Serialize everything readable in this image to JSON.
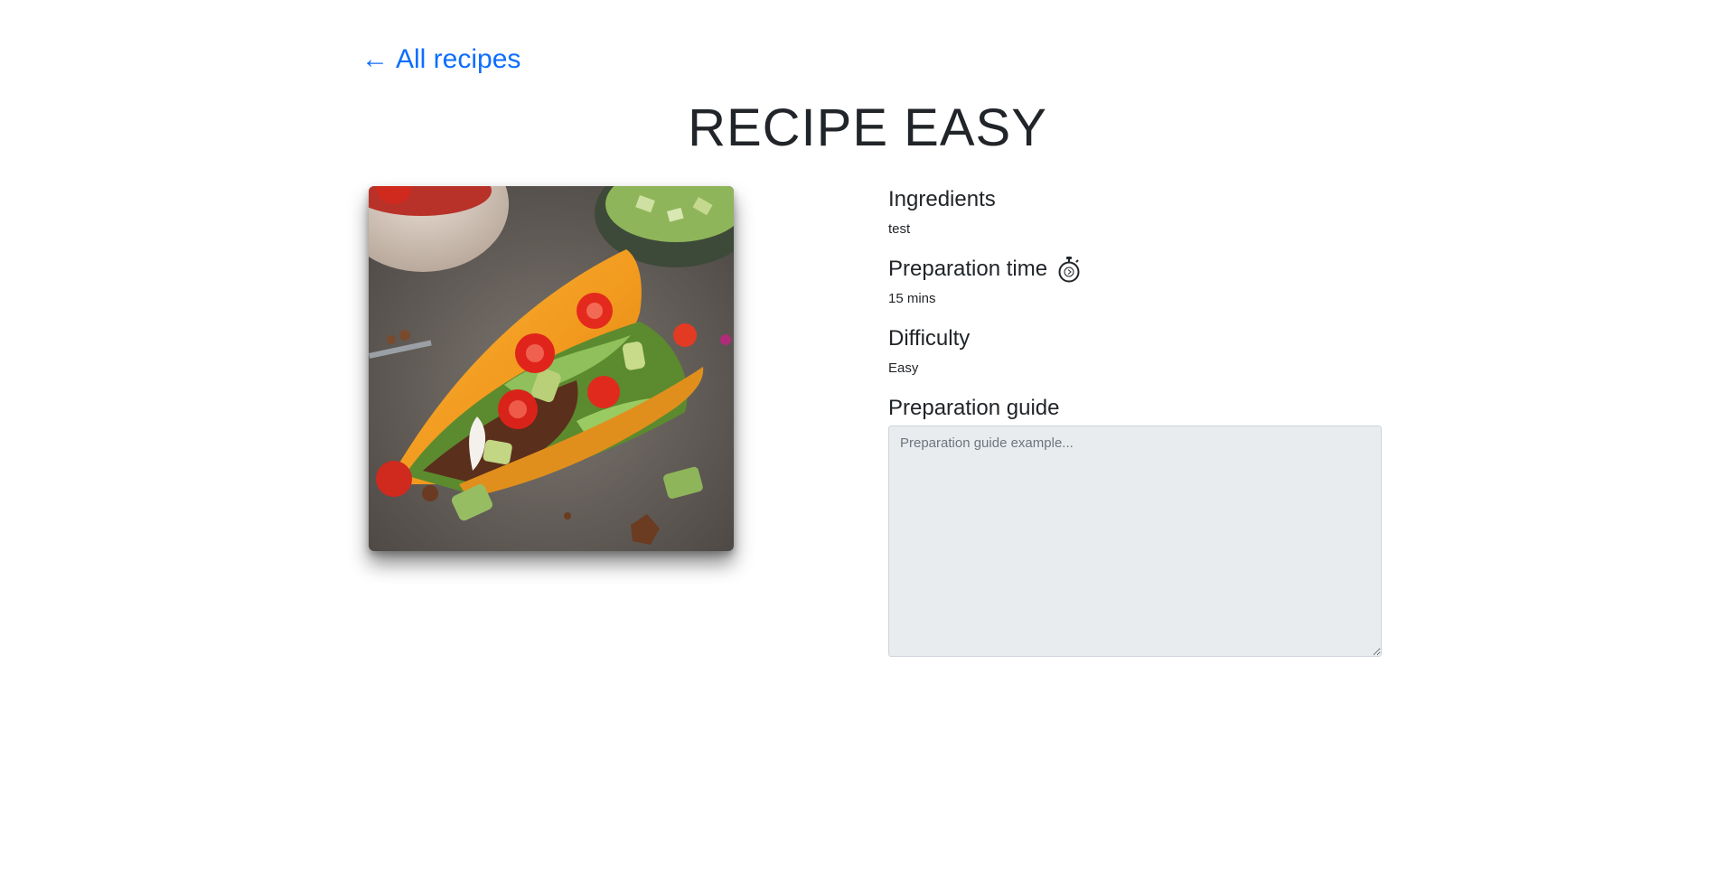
{
  "nav": {
    "back_arrow": "←",
    "back_label": "All recipes"
  },
  "recipe": {
    "title": "RECIPE EASY",
    "image_alt": "taco-photo",
    "sections": {
      "ingredients": {
        "heading": "Ingredients",
        "value": "test"
      },
      "prep_time": {
        "heading": "Preparation time",
        "value": "15 mins",
        "icon": "stopwatch-icon"
      },
      "difficulty": {
        "heading": "Difficulty",
        "value": "Easy"
      },
      "guide": {
        "heading": "Preparation guide",
        "placeholder": "Preparation guide example..."
      }
    }
  },
  "colors": {
    "link": "#0d6efd",
    "text": "#212529",
    "textarea_bg": "#e9ecef"
  }
}
